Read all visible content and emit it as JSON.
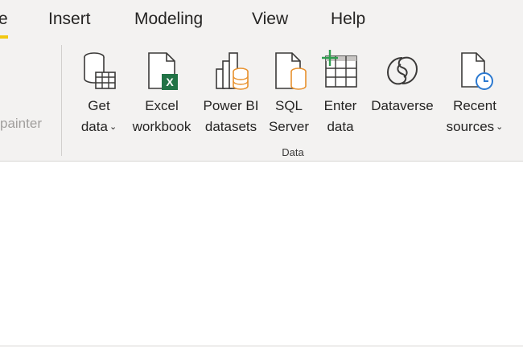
{
  "tabs": [
    {
      "label": "e"
    },
    {
      "label": "Insert"
    },
    {
      "label": "Modeling"
    },
    {
      "label": "View"
    },
    {
      "label": "Help"
    }
  ],
  "clipboard": {
    "format_painter": "painter"
  },
  "data_group": {
    "label": "Data",
    "buttons": [
      {
        "line1": "Get",
        "line2": "data",
        "has_dropdown": true,
        "icon": "database-table-icon"
      },
      {
        "line1": "Excel",
        "line2": "workbook",
        "has_dropdown": false,
        "icon": "excel-file-icon"
      },
      {
        "line1": "Power BI",
        "line2": "datasets",
        "has_dropdown": false,
        "icon": "powerbi-dataset-icon"
      },
      {
        "line1": "SQL",
        "line2": "Server",
        "has_dropdown": false,
        "icon": "sql-server-icon"
      },
      {
        "line1": "Enter",
        "line2": "data",
        "has_dropdown": false,
        "icon": "enter-data-table-icon"
      },
      {
        "line1": "Dataverse",
        "line2": "",
        "has_dropdown": false,
        "icon": "dataverse-icon"
      },
      {
        "line1": "Recent",
        "line2": "sources",
        "has_dropdown": true,
        "icon": "recent-sources-clock-icon"
      }
    ]
  },
  "colors": {
    "accent_yellow": "#f2c811",
    "excel_green": "#217346",
    "data_orange": "#e8912d",
    "clock_blue": "#2b79d0",
    "ribbon_bg": "#f3f2f1"
  }
}
